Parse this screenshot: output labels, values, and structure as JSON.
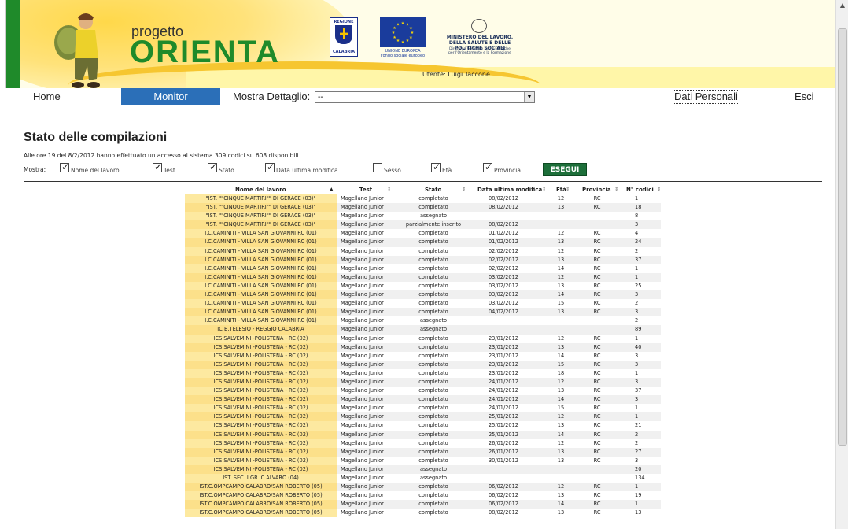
{
  "banner": {
    "logo_small": "progetto",
    "logo_big": "ORIENTA",
    "regione_top": "REGIONE",
    "regione_bottom": "CALABRIA",
    "eu_line1": "UNIONE EUROPEA",
    "eu_line2": "Fondo sociale europeo",
    "ministry_line1": "MINISTERO DEL LAVORO,",
    "ministry_line2": "DELLA SALUTE E DELLE POLITICHE SOCIALI",
    "ministry_sub1": "Direzione Generale per le Politiche",
    "ministry_sub2": "per l'Orientamento e la Formazione",
    "user": "Utente:  Luigi Taccone"
  },
  "nav": {
    "home": "Home",
    "monitor": "Monitor",
    "mostra_dettaglio": "Mostra Dettaglio:",
    "select_value": "--",
    "dati_personali": "Dati Personali",
    "esci": "Esci"
  },
  "page": {
    "title": "Stato delle compilazioni",
    "summary": "Alle ore 19 del 8/2/2012 hanno effettuato un accesso al sistema 309 codici su 608 disponibili."
  },
  "filters": {
    "label": "Mostra:",
    "items": [
      {
        "label": "Nome del lavoro",
        "checked": true
      },
      {
        "label": "Test",
        "checked": true
      },
      {
        "label": "Stato",
        "checked": true
      },
      {
        "label": "Data ultima modifica",
        "checked": true
      },
      {
        "label": "Sesso",
        "checked": false
      },
      {
        "label": "Età",
        "checked": true
      },
      {
        "label": "Provincia",
        "checked": true
      }
    ],
    "button": "ESEGUI"
  },
  "table": {
    "headers": [
      "Nome del lavoro",
      "Test",
      "Stato",
      "Data ultima modifica",
      "Età",
      "Provincia",
      "N° codici"
    ],
    "sort_asc": "▲",
    "sort_none": "⇕",
    "rows": [
      [
        "\"IST. \"\"CINQUE MARTIRI\"\" DI GERACE (03)\"",
        "Magellano Junior",
        "completato",
        "08/02/2012",
        "12",
        "RC",
        "1"
      ],
      [
        "\"IST. \"\"CINQUE MARTIRI\"\" DI GERACE (03)\"",
        "Magellano Junior",
        "completato",
        "08/02/2012",
        "13",
        "RC",
        "18"
      ],
      [
        "\"IST. \"\"CINQUE MARTIRI\"\" DI GERACE (03)\"",
        "Magellano Junior",
        "assegnato",
        "",
        "",
        "",
        "8"
      ],
      [
        "\"IST. \"\"CINQUE MARTIRI\"\" DI GERACE (03)\"",
        "Magellano Junior",
        "parzialmente inserito",
        "08/02/2012",
        "",
        "",
        "3"
      ],
      [
        "I.C.CAMINITI - VILLA SAN GIOVANNI RC (01)",
        "Magellano Junior",
        "completato",
        "01/02/2012",
        "12",
        "RC",
        "4"
      ],
      [
        "I.C.CAMINITI - VILLA SAN GIOVANNI RC (01)",
        "Magellano Junior",
        "completato",
        "01/02/2012",
        "13",
        "RC",
        "24"
      ],
      [
        "I.C.CAMINITI - VILLA SAN GIOVANNI RC (01)",
        "Magellano Junior",
        "completato",
        "02/02/2012",
        "12",
        "RC",
        "2"
      ],
      [
        "I.C.CAMINITI - VILLA SAN GIOVANNI RC (01)",
        "Magellano Junior",
        "completato",
        "02/02/2012",
        "13",
        "RC",
        "37"
      ],
      [
        "I.C.CAMINITI - VILLA SAN GIOVANNI RC (01)",
        "Magellano Junior",
        "completato",
        "02/02/2012",
        "14",
        "RC",
        "1"
      ],
      [
        "I.C.CAMINITI - VILLA SAN GIOVANNI RC (01)",
        "Magellano Junior",
        "completato",
        "03/02/2012",
        "12",
        "RC",
        "1"
      ],
      [
        "I.C.CAMINITI - VILLA SAN GIOVANNI RC (01)",
        "Magellano Junior",
        "completato",
        "03/02/2012",
        "13",
        "RC",
        "25"
      ],
      [
        "I.C.CAMINITI - VILLA SAN GIOVANNI RC (01)",
        "Magellano Junior",
        "completato",
        "03/02/2012",
        "14",
        "RC",
        "3"
      ],
      [
        "I.C.CAMINITI - VILLA SAN GIOVANNI RC (01)",
        "Magellano Junior",
        "completato",
        "03/02/2012",
        "15",
        "RC",
        "2"
      ],
      [
        "I.C.CAMINITI - VILLA SAN GIOVANNI RC (01)",
        "Magellano Junior",
        "completato",
        "04/02/2012",
        "13",
        "RC",
        "3"
      ],
      [
        "I.C.CAMINITI - VILLA SAN GIOVANNI RC (01)",
        "Magellano Junior",
        "assegnato",
        "",
        "",
        "",
        "2"
      ],
      [
        "IC B.TELESIO - REGGIO CALABRIA",
        "Magellano Junior",
        "assegnato",
        "",
        "",
        "",
        "89"
      ],
      [
        "ICS SALVEMINI -POLISTENA - RC (02)",
        "Magellano Junior",
        "completato",
        "23/01/2012",
        "12",
        "RC",
        "1"
      ],
      [
        "ICS SALVEMINI -POLISTENA - RC (02)",
        "Magellano Junior",
        "completato",
        "23/01/2012",
        "13",
        "RC",
        "40"
      ],
      [
        "ICS SALVEMINI -POLISTENA - RC (02)",
        "Magellano Junior",
        "completato",
        "23/01/2012",
        "14",
        "RC",
        "3"
      ],
      [
        "ICS SALVEMINI -POLISTENA - RC (02)",
        "Magellano Junior",
        "completato",
        "23/01/2012",
        "15",
        "RC",
        "3"
      ],
      [
        "ICS SALVEMINI -POLISTENA - RC (02)",
        "Magellano Junior",
        "completato",
        "23/01/2012",
        "18",
        "RC",
        "1"
      ],
      [
        "ICS SALVEMINI -POLISTENA - RC (02)",
        "Magellano Junior",
        "completato",
        "24/01/2012",
        "12",
        "RC",
        "3"
      ],
      [
        "ICS SALVEMINI -POLISTENA - RC (02)",
        "Magellano Junior",
        "completato",
        "24/01/2012",
        "13",
        "RC",
        "37"
      ],
      [
        "ICS SALVEMINI -POLISTENA - RC (02)",
        "Magellano Junior",
        "completato",
        "24/01/2012",
        "14",
        "RC",
        "3"
      ],
      [
        "ICS SALVEMINI -POLISTENA - RC (02)",
        "Magellano Junior",
        "completato",
        "24/01/2012",
        "15",
        "RC",
        "1"
      ],
      [
        "ICS SALVEMINI -POLISTENA - RC (02)",
        "Magellano Junior",
        "completato",
        "25/01/2012",
        "12",
        "RC",
        "1"
      ],
      [
        "ICS SALVEMINI -POLISTENA - RC (02)",
        "Magellano Junior",
        "completato",
        "25/01/2012",
        "13",
        "RC",
        "21"
      ],
      [
        "ICS SALVEMINI -POLISTENA - RC (02)",
        "Magellano Junior",
        "completato",
        "25/01/2012",
        "14",
        "RC",
        "2"
      ],
      [
        "ICS SALVEMINI -POLISTENA - RC (02)",
        "Magellano Junior",
        "completato",
        "26/01/2012",
        "12",
        "RC",
        "2"
      ],
      [
        "ICS SALVEMINI -POLISTENA - RC (02)",
        "Magellano Junior",
        "completato",
        "26/01/2012",
        "13",
        "RC",
        "27"
      ],
      [
        "ICS SALVEMINI -POLISTENA - RC (02)",
        "Magellano Junior",
        "completato",
        "30/01/2012",
        "13",
        "RC",
        "3"
      ],
      [
        "ICS SALVEMINI -POLISTENA - RC (02)",
        "Magellano Junior",
        "assegnato",
        "",
        "",
        "",
        "20"
      ],
      [
        "IST. SEC. I GR. C.ALVARO (04)",
        "Magellano Junior",
        "assegnato",
        "",
        "",
        "",
        "134"
      ],
      [
        "IST.C.OMPCAMPO CALABRO/SAN ROBERTO (05)",
        "Magellano Junior",
        "completato",
        "06/02/2012",
        "12",
        "RC",
        "1"
      ],
      [
        "IST.C.OMPCAMPO CALABRO/SAN ROBERTO (05)",
        "Magellano Junior",
        "completato",
        "06/02/2012",
        "13",
        "RC",
        "19"
      ],
      [
        "IST.C.OMPCAMPO CALABRO/SAN ROBERTO (05)",
        "Magellano Junior",
        "completato",
        "06/02/2012",
        "14",
        "RC",
        "1"
      ],
      [
        "IST.C.OMPCAMPO CALABRO/SAN ROBERTO (05)",
        "Magellano Junior",
        "completato",
        "08/02/2012",
        "13",
        "RC",
        "13"
      ]
    ]
  },
  "colors": {
    "brand_green": "#1f8a2a",
    "nav_active": "#2b6fb8",
    "button_green": "#1d6f3a",
    "name_cell": "#fde9a0"
  }
}
